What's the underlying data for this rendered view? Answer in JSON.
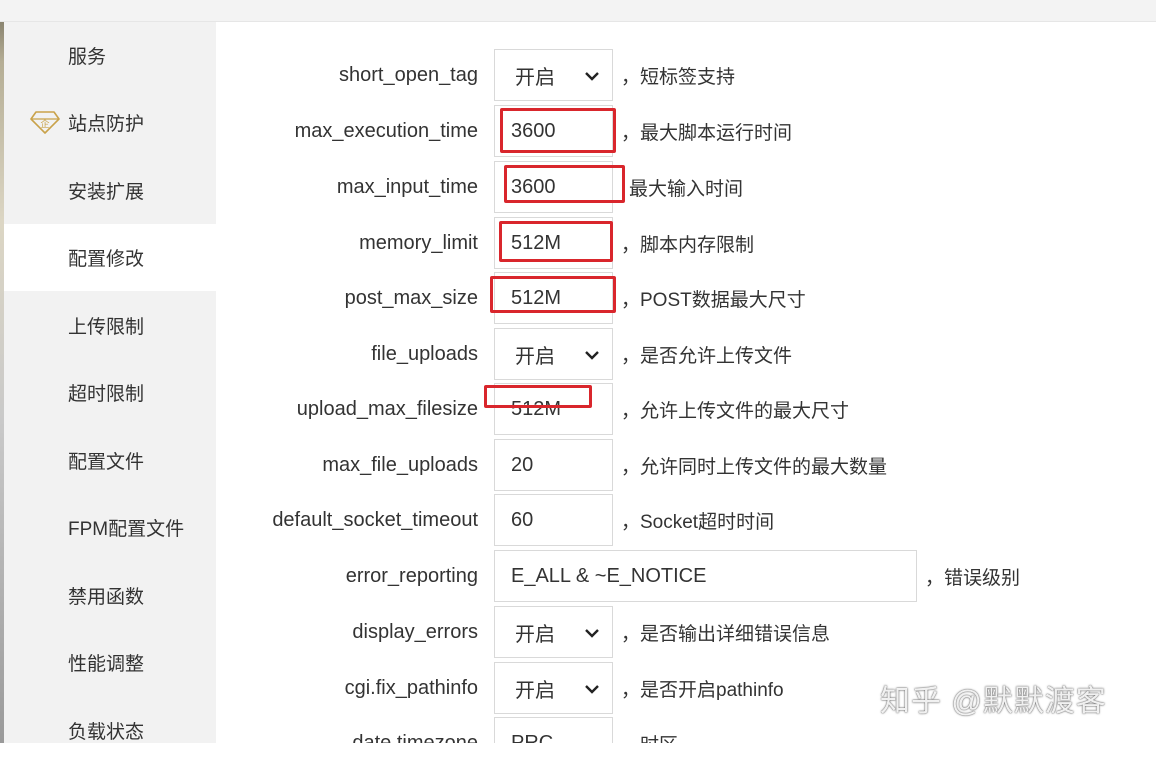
{
  "sidebar": {
    "items": [
      {
        "label": "服务",
        "active": false
      },
      {
        "label": "站点防护",
        "active": false,
        "icon": "enterprise-diamond-icon"
      },
      {
        "label": "安装扩展",
        "active": false
      },
      {
        "label": "配置修改",
        "active": true
      },
      {
        "label": "上传限制",
        "active": false
      },
      {
        "label": "超时限制",
        "active": false
      },
      {
        "label": "配置文件",
        "active": false
      },
      {
        "label": "FPM配置文件",
        "active": false
      },
      {
        "label": "禁用函数",
        "active": false
      },
      {
        "label": "性能调整",
        "active": false
      },
      {
        "label": "负载状态",
        "active": false
      }
    ],
    "icon_badge": "企"
  },
  "settings": [
    {
      "key": "short_open_tag",
      "value": "开启",
      "type": "select",
      "desc": "，短标签支持"
    },
    {
      "key": "max_execution_time",
      "value": "3600",
      "type": "input",
      "desc": "，最大脚本运行时间"
    },
    {
      "key": "max_input_time",
      "value": "3600",
      "type": "input",
      "desc": "最大输入时间"
    },
    {
      "key": "memory_limit",
      "value": "512M",
      "type": "input",
      "desc": "，脚本内存限制"
    },
    {
      "key": "post_max_size",
      "value": "512M",
      "type": "input",
      "desc": "，POST数据最大尺寸"
    },
    {
      "key": "file_uploads",
      "value": "开启",
      "type": "select",
      "desc": "，是否允许上传文件"
    },
    {
      "key": "upload_max_filesize",
      "value": "512M",
      "type": "input",
      "desc": "，允许上传文件的最大尺寸"
    },
    {
      "key": "max_file_uploads",
      "value": "20",
      "type": "input",
      "desc": "，允许同时上传文件的最大数量"
    },
    {
      "key": "default_socket_timeout",
      "value": "60",
      "type": "input",
      "desc": "，Socket超时时间"
    },
    {
      "key": "error_reporting",
      "value": "E_ALL & ~E_NOTICE",
      "type": "input-wide",
      "desc": "，错误级别"
    },
    {
      "key": "display_errors",
      "value": "开启",
      "type": "select",
      "desc": "，是否输出详细错误信息"
    },
    {
      "key": "cgi.fix_pathinfo",
      "value": "开启",
      "type": "select",
      "desc": "，是否开启pathinfo"
    },
    {
      "key": "date.timezone",
      "value": "PRC",
      "type": "input",
      "desc": "，时区"
    }
  ],
  "watermark": "知乎 @默默渡客",
  "colors": {
    "highlight": "#d9262c",
    "sidebar_bg": "#f2f2f2",
    "active_bg": "#ffffff",
    "text": "#333333",
    "border": "#d9d9d9"
  }
}
